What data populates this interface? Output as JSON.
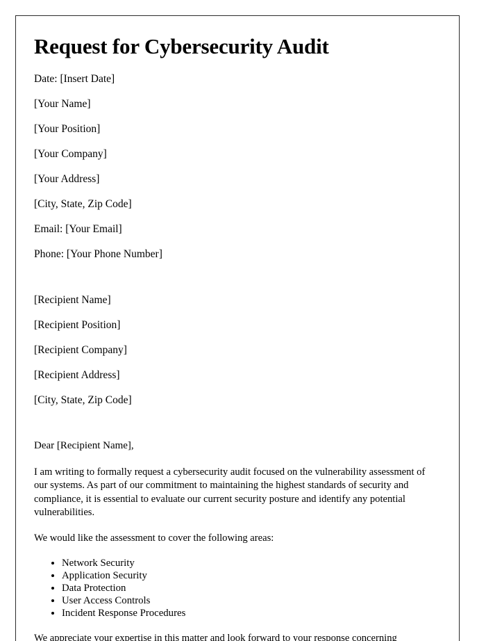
{
  "document": {
    "title": "Request for Cybersecurity Audit",
    "date_line": "Date: [Insert Date]",
    "sender": {
      "name": "[Your Name]",
      "position": "[Your Position]",
      "company": "[Your Company]",
      "address": "[Your Address]",
      "city_state_zip": "[City, State, Zip Code]",
      "email": "Email: [Your Email]",
      "phone": "Phone: [Your Phone Number]"
    },
    "recipient": {
      "name": "[Recipient Name]",
      "position": "[Recipient Position]",
      "company": "[Recipient Company]",
      "address": "[Recipient Address]",
      "city_state_zip": "[City, State, Zip Code]"
    },
    "salutation": "Dear [Recipient Name],",
    "paragraph_1": "I am writing to formally request a cybersecurity audit focused on the vulnerability assessment of our systems. As part of our commitment to maintaining the highest standards of security and compliance, it is essential to evaluate our current security posture and identify any potential vulnerabilities.",
    "paragraph_2": "We would like the assessment to cover the following areas:",
    "areas": [
      "Network Security",
      "Application Security",
      "Data Protection",
      "User Access Controls",
      "Incident Response Procedures"
    ],
    "paragraph_3": "We appreciate your expertise in this matter and look forward to your response concerning"
  }
}
